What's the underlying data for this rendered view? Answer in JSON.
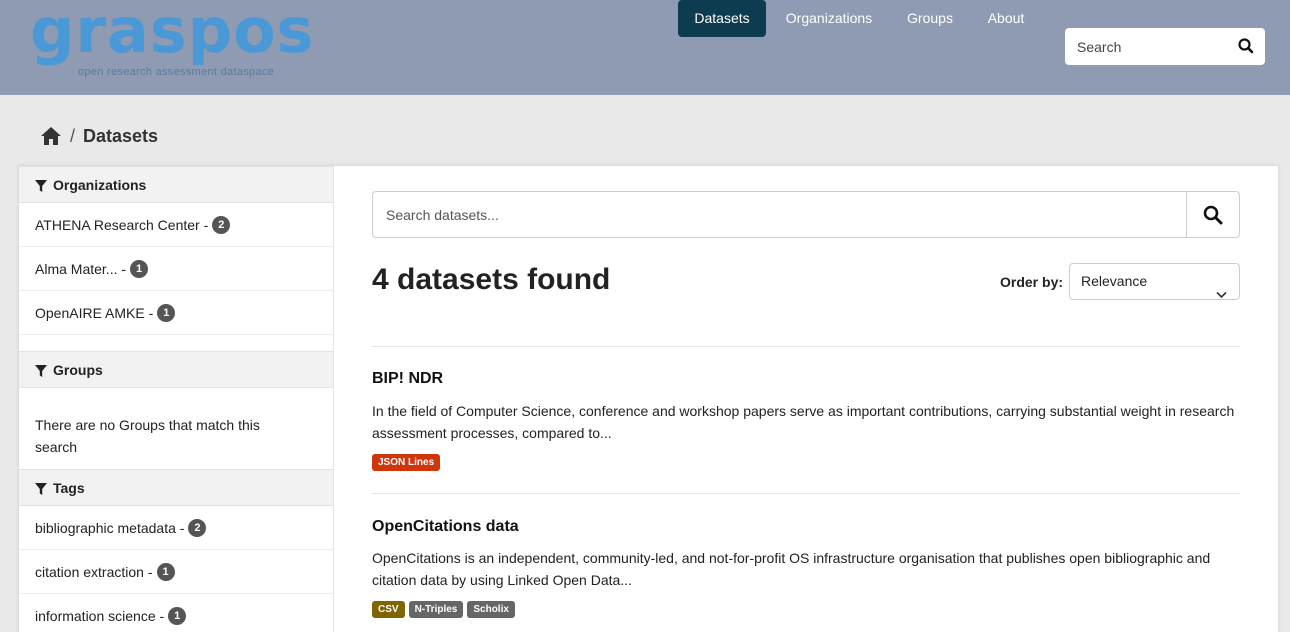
{
  "brand": {
    "name": "graspos",
    "tagline": "open research assessment dataspace"
  },
  "colors": {
    "header_bg": "#8e9bb2",
    "nav_active": "#0d3b4f",
    "logo_blue": "#4a98d6",
    "logo_pink": "#c8407a",
    "fmt_jsonl": "#d0360c",
    "fmt_csv": "#7e6500",
    "fmt_ntriples": "#666666",
    "fmt_scholix": "#666666"
  },
  "nav": {
    "items": [
      {
        "label": "Datasets",
        "active": true
      },
      {
        "label": "Organizations",
        "active": false
      },
      {
        "label": "Groups",
        "active": false
      },
      {
        "label": "About",
        "active": false
      }
    ],
    "search_placeholder": "Search"
  },
  "breadcrumb": {
    "current": "Datasets"
  },
  "facets": {
    "organizations": {
      "title": "Organizations",
      "items": [
        {
          "label": "ATHENA Research Center - ",
          "count": "2"
        },
        {
          "label": "Alma Mater... - ",
          "count": "1"
        },
        {
          "label": "OpenAIRE AMKE - ",
          "count": "1"
        }
      ]
    },
    "groups": {
      "title": "Groups",
      "empty": "There are no Groups that match this search"
    },
    "tags": {
      "title": "Tags",
      "items": [
        {
          "label": "bibliographic metadata - ",
          "count": "2"
        },
        {
          "label": "citation extraction - ",
          "count": "1"
        },
        {
          "label": "information science - ",
          "count": "1"
        }
      ]
    }
  },
  "main": {
    "search_placeholder": "Search datasets...",
    "results_count": "4 datasets found",
    "order_label": "Order by:",
    "order_value": "Relevance",
    "datasets": [
      {
        "title": "BIP! NDR",
        "description": "In the field of Computer Science, conference and workshop papers serve as important contributions, carrying substantial weight in research assessment processes, compared to...",
        "formats": [
          "JSON Lines"
        ]
      },
      {
        "title": "OpenCitations data",
        "description": "OpenCitations is an independent, community-led, and not-for-profit OS infrastructure organisation that publishes open bibliographic and citation data by using Linked Open Data...",
        "formats": [
          "CSV",
          "N-Triples",
          "Scholix"
        ]
      }
    ]
  }
}
